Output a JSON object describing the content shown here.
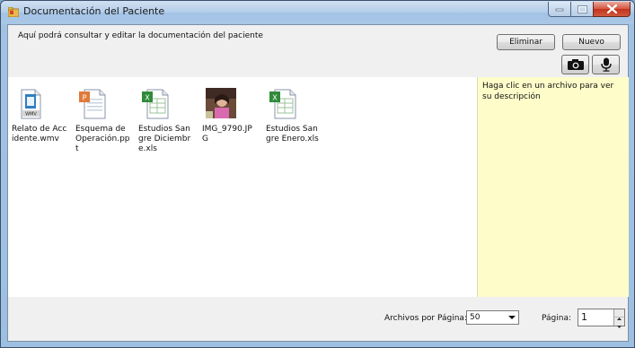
{
  "window": {
    "title": "Documentación del Paciente"
  },
  "header": {
    "description": "Aquí podrá consultar y editar la documentación del paciente"
  },
  "toolbar": {
    "delete_label": "Eliminar",
    "new_label": "Nuevo",
    "camera_icon": "camera-icon",
    "mic_icon": "microphone-icon"
  },
  "files": [
    {
      "name": "Relato de Accidente.wmv",
      "type": "wmv"
    },
    {
      "name": "Esquema de Operación.ppt",
      "type": "ppt"
    },
    {
      "name": "Estudios Sangre Diciembre.xls",
      "type": "xls"
    },
    {
      "name": "IMG_9790.JPG",
      "type": "jpg"
    },
    {
      "name": "Estudios Sangre Enero.xls",
      "type": "xls"
    }
  ],
  "description_panel": {
    "hint": "Haga clic en un archivo para ver su descripción"
  },
  "footer": {
    "per_page_label": "Archivos por Página:",
    "per_page_value": "50",
    "page_label": "Página:",
    "page_value": "1"
  },
  "colors": {
    "description_bg": "#fefcc9",
    "close_button": "#c2321c"
  }
}
